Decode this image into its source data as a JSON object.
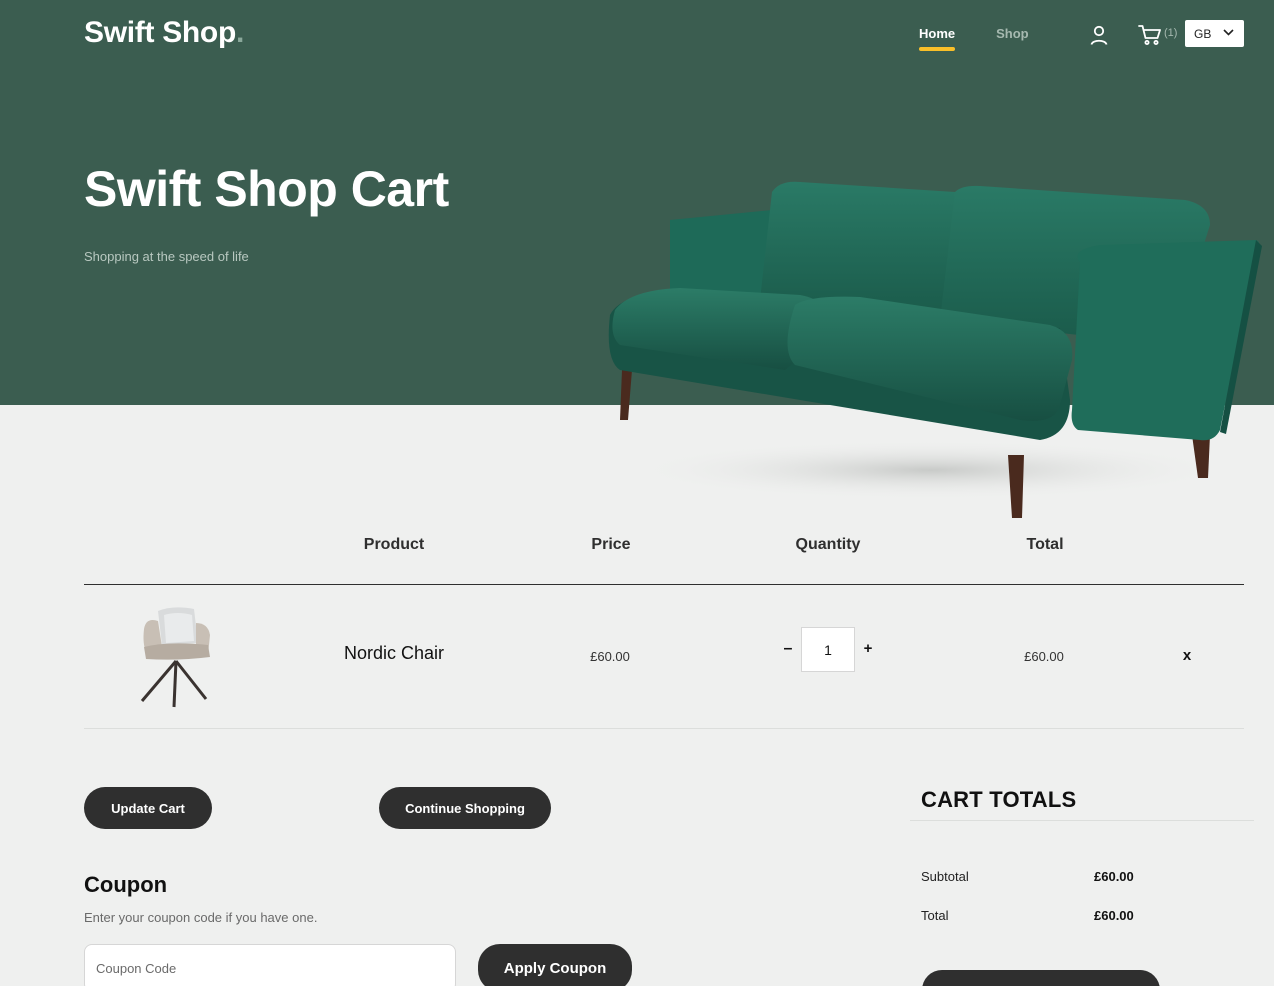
{
  "header": {
    "brand": "Swift Shop",
    "brand_dot": ".",
    "nav": {
      "home": "Home",
      "shop": "Shop"
    },
    "cart_count": "(1)",
    "language": "GB",
    "icons": {
      "user": "user-icon",
      "cart": "cart-icon",
      "dropdown": "chevron-down-icon"
    }
  },
  "hero": {
    "title": "Swift Shop Cart",
    "subtitle": "Shopping at the speed of life"
  },
  "cart_table": {
    "headers": {
      "product": "Product",
      "price": "Price",
      "quantity": "Quantity",
      "total": "Total"
    },
    "rows": [
      {
        "name": "Nordic Chair",
        "price": "£60.00",
        "quantity": "1",
        "total": "£60.00",
        "remove": "x",
        "minus": "–",
        "plus": "+"
      }
    ]
  },
  "actions": {
    "update_cart": "Update Cart",
    "continue_shopping": "Continue Shopping"
  },
  "coupon": {
    "title": "Coupon",
    "subtitle": "Enter your coupon code if you have one.",
    "placeholder": "Coupon Code",
    "apply": "Apply Coupon"
  },
  "totals": {
    "title": "CART TOTALS",
    "subtotal_label": "Subtotal",
    "subtotal_value": "£60.00",
    "total_label": "Total",
    "total_value": "£60.00"
  },
  "colors": {
    "hero_bg": "#3b5d50",
    "page_bg": "#eff0ef",
    "accent": "#f9bf29",
    "button_bg": "#2f2f2f",
    "sofa": "#1f6655"
  }
}
